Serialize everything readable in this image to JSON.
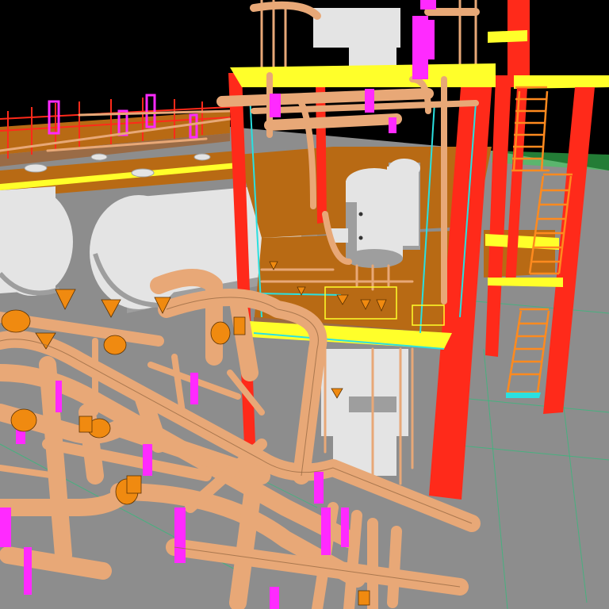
{
  "scene": {
    "colors": {
      "sky": "#000000",
      "ground": "#8d8d8d",
      "grid_line": "#2bbf7a",
      "structural_steel": "#ff2a1a",
      "beams": "#ffff2a",
      "platform_deck": "#b86a14",
      "ladders_and_stairs": "#ff8a1e",
      "piping": "#e8a877",
      "piping_shadow": "#9a6b45",
      "pipe_flanges": "#ff2aff",
      "vessels": "#e4e4e4",
      "vessel_shadow": "#9e9e9e",
      "valves": "#f08a10",
      "instrument_lines": "#2ae0e0",
      "small_bore_lines": "#3ad05a"
    },
    "objects": [
      "pipe-rack",
      "horizontal-storage-tank",
      "vertical-pressure-vessel",
      "steel-structure-frame",
      "access-stair",
      "platform-deck",
      "process-piping",
      "valve"
    ]
  }
}
